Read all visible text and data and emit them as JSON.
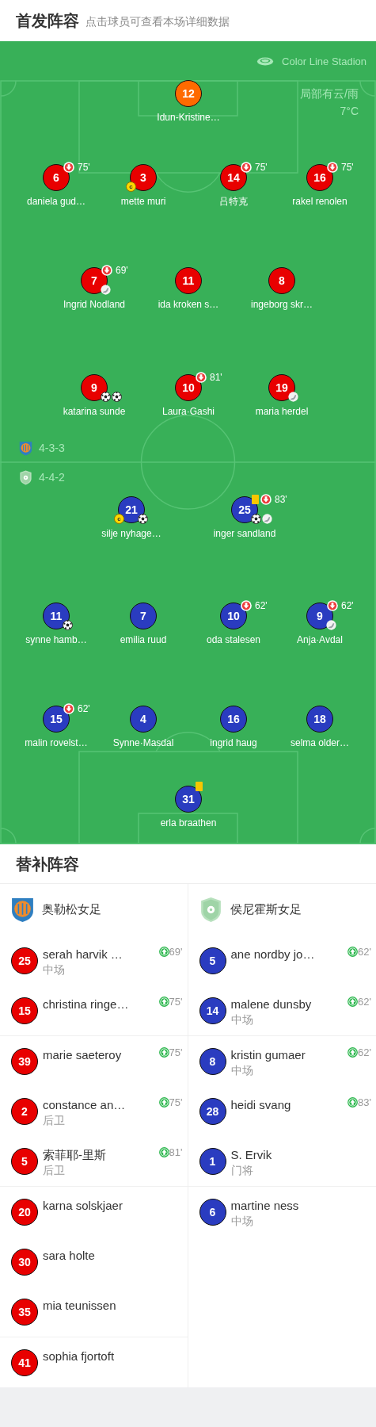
{
  "header": {
    "title": "首发阵容",
    "subtitle": "点击球员可查看本场详细数据"
  },
  "pitch": {
    "stadium": "Color Line Stadion",
    "weather": "局部有云/雨",
    "temperature": "7°C",
    "teams": [
      {
        "formation": "4-3-3",
        "kind": "home",
        "lines": [
          [
            {
              "number": "12",
              "name": "Idun-Kristine…",
              "color": "#ff6a00"
            }
          ],
          [
            {
              "number": "6",
              "name": "daniela gud…",
              "color": "#e80000",
              "events": [
                {
                  "kind": "sub_out",
                  "minute": "75'"
                }
              ]
            },
            {
              "number": "3",
              "name": "mette muri",
              "color": "#e80000",
              "events": [
                {
                  "kind": "captain",
                  "label": "c"
                }
              ]
            },
            {
              "number": "14",
              "name": "吕特克",
              "color": "#e80000",
              "events": [
                {
                  "kind": "sub_out",
                  "minute": "75'"
                }
              ]
            },
            {
              "number": "16",
              "name": "rakel renolen",
              "color": "#e80000",
              "events": [
                {
                  "kind": "sub_out",
                  "minute": "75'"
                }
              ]
            }
          ],
          [
            {
              "number": "7",
              "name": "Ingrid Nodland",
              "color": "#e80000",
              "events": [
                {
                  "kind": "sub_out",
                  "minute": "69'"
                },
                {
                  "kind": "assist"
                }
              ]
            },
            {
              "number": "11",
              "name": "ida kroken s…",
              "color": "#e80000"
            },
            {
              "number": "8",
              "name": "ingeborg skr…",
              "color": "#e80000"
            }
          ],
          [
            {
              "number": "9",
              "name": "katarina sunde",
              "color": "#e80000",
              "events": [
                {
                  "kind": "goal"
                },
                {
                  "kind": "goal"
                }
              ]
            },
            {
              "number": "10",
              "name": "Laura·Gashi",
              "color": "#e80000",
              "events": [
                {
                  "kind": "sub_out",
                  "minute": "81'"
                }
              ]
            },
            {
              "number": "19",
              "name": "maria herdel",
              "color": "#e80000",
              "events": [
                {
                  "kind": "assist"
                }
              ]
            }
          ]
        ]
      },
      {
        "formation": "4-4-2",
        "kind": "away",
        "lines": [
          [
            {
              "number": "21",
              "name": "silje nyhage…",
              "color": "#2a3cc0",
              "events": [
                {
                  "kind": "captain",
                  "label": "c"
                },
                {
                  "kind": "goal"
                }
              ]
            },
            {
              "number": "25",
              "name": "inger sandland",
              "color": "#2a3cc0",
              "events": [
                {
                  "kind": "yellow_card"
                },
                {
                  "kind": "sub_out",
                  "minute": "83'"
                },
                {
                  "kind": "goal"
                },
                {
                  "kind": "assist"
                }
              ]
            }
          ],
          [
            {
              "number": "11",
              "name": "synne hamb…",
              "color": "#2a3cc0",
              "events": [
                {
                  "kind": "goal"
                }
              ]
            },
            {
              "number": "7",
              "name": "emilia ruud",
              "color": "#2a3cc0"
            },
            {
              "number": "10",
              "name": "oda stalesen",
              "color": "#2a3cc0",
              "events": [
                {
                  "kind": "sub_out",
                  "minute": "62'"
                }
              ]
            },
            {
              "number": "9",
              "name": "Anja·Avdal",
              "color": "#2a3cc0",
              "events": [
                {
                  "kind": "sub_out",
                  "minute": "62'"
                },
                {
                  "kind": "assist"
                }
              ]
            }
          ],
          [
            {
              "number": "15",
              "name": "malin rovelst…",
              "color": "#2a3cc0",
              "events": [
                {
                  "kind": "sub_out",
                  "minute": "62'"
                }
              ]
            },
            {
              "number": "4",
              "name": "Synne·Masdal",
              "color": "#2a3cc0"
            },
            {
              "number": "16",
              "name": "ingrid haug",
              "color": "#2a3cc0"
            },
            {
              "number": "18",
              "name": "selma older…",
              "color": "#2a3cc0"
            }
          ],
          [
            {
              "number": "31",
              "name": "erla braathen",
              "color": "#2a3cc0",
              "events": [
                {
                  "kind": "yellow_card"
                }
              ]
            }
          ]
        ]
      }
    ]
  },
  "substitutes": {
    "title": "替补阵容",
    "teams": [
      {
        "name": "奥勒松女足",
        "kind": "home",
        "color": "#e80000",
        "groups": [
          [
            {
              "number": "25",
              "name": "serah harvik …",
              "position": "中场",
              "sub_in": "69'"
            },
            {
              "number": "15",
              "name": "christina ringe…",
              "sub_in": "75'"
            }
          ],
          [
            {
              "number": "39",
              "name": "marie saeteroy",
              "sub_in": "75'"
            },
            {
              "number": "2",
              "name": "constance an…",
              "position": "后卫",
              "sub_in": "75'"
            },
            {
              "number": "5",
              "name": "索菲耶-里斯",
              "position": "后卫",
              "sub_in": "81'"
            }
          ],
          [
            {
              "number": "20",
              "name": "karna solskjaer"
            },
            {
              "number": "30",
              "name": "sara holte"
            },
            {
              "number": "35",
              "name": "mia teunissen"
            }
          ],
          [
            {
              "number": "41",
              "name": "sophia fjortoft"
            }
          ]
        ]
      },
      {
        "name": "侯尼霍斯女足",
        "kind": "away",
        "color": "#2a3cc0",
        "groups": [
          [
            {
              "number": "5",
              "name": "ane nordby jo…",
              "sub_in": "62'"
            },
            {
              "number": "14",
              "name": "malene dunsby",
              "position": "中场",
              "sub_in": "62'"
            }
          ],
          [
            {
              "number": "8",
              "name": "kristin gumaer",
              "position": "中场",
              "sub_in": "62'"
            },
            {
              "number": "28",
              "name": "heidi svang",
              "sub_in": "83'"
            },
            {
              "number": "1",
              "name": "S. Ervik",
              "position": "门将"
            }
          ],
          [
            {
              "number": "6",
              "name": "martine ness",
              "position": "中场"
            }
          ]
        ]
      }
    ]
  }
}
